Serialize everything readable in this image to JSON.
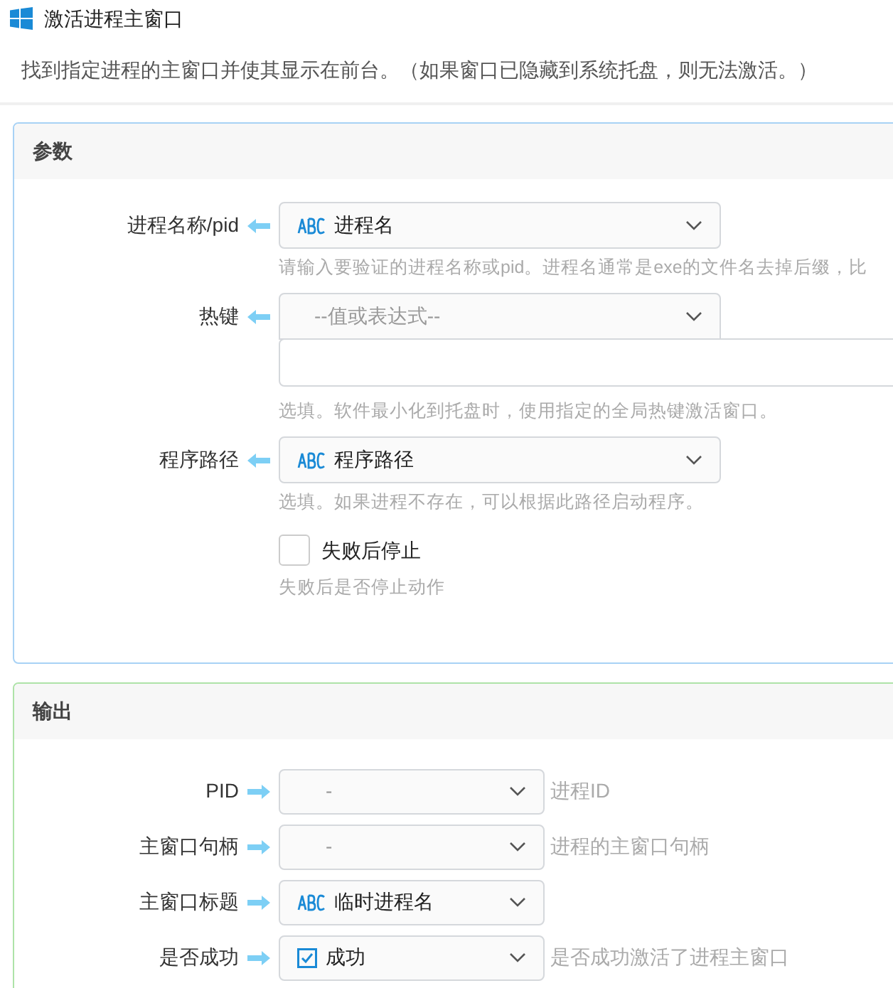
{
  "window": {
    "title": "激活进程主窗口"
  },
  "description": "找到指定进程的主窗口并使其显示在前台。（如果窗口已隐藏到系统托盘，则无法激活。）",
  "params": {
    "title": "参数",
    "items": [
      {
        "kind": "select",
        "label": "进程名称/pid",
        "value": "进程名",
        "hint": "请输入要验证的进程名称或pid。进程名通常是exe的文件名去掉后缀，比"
      },
      {
        "kind": "expression",
        "label": "热键",
        "placeholder": "--值或表达式--",
        "hint": "选填。软件最小化到托盘时，使用指定的全局热键激活窗口。"
      },
      {
        "kind": "select",
        "label": "程序路径",
        "value": "程序路径",
        "hint": "选填。如果进程不存在，可以根据此路径启动程序。"
      },
      {
        "kind": "checkbox",
        "label": "失败后停止",
        "checked": false,
        "hint": "失败后是否停止动作"
      }
    ]
  },
  "outputs": {
    "title": "输出",
    "items": [
      {
        "kind": "empty",
        "label": "PID",
        "value": "-",
        "hint": "进程ID"
      },
      {
        "kind": "empty",
        "label": "主窗口句柄",
        "value": "-",
        "hint": "进程的主窗口句柄"
      },
      {
        "kind": "text",
        "label": "主窗口标题",
        "value": "临时进程名"
      },
      {
        "kind": "bool",
        "label": "是否成功",
        "value": "成功",
        "hint": "是否成功激活了进程主窗口"
      }
    ]
  }
}
